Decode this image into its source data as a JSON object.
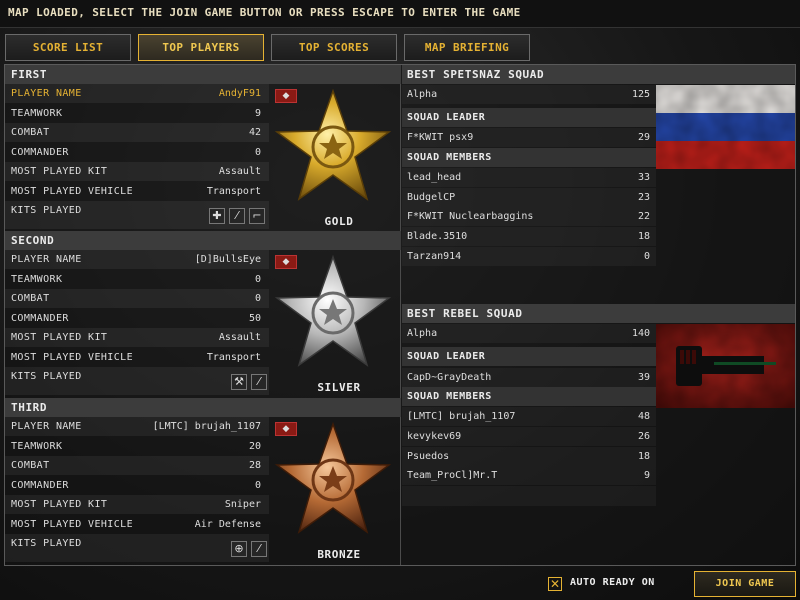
{
  "banner": "MAP LOADED, SELECT THE JOIN GAME BUTTON OR PRESS ESCAPE TO ENTER THE GAME",
  "tabs": [
    {
      "label": "SCORE LIST"
    },
    {
      "label": "TOP PLAYERS"
    },
    {
      "label": "TOP SCORES"
    },
    {
      "label": "MAP BRIEFING"
    }
  ],
  "active_tab": "TOP PLAYERS",
  "stat_labels": {
    "player_name": "PLAYER NAME",
    "teamwork": "TEAMWORK",
    "combat": "COMBAT",
    "commander": "COMMANDER",
    "kit": "MOST PLAYED KIT",
    "vehicle": "MOST PLAYED VEHICLE",
    "kits_played": "KITS PLAYED"
  },
  "players": [
    {
      "place": "FIRST",
      "medal": "GOLD",
      "name": "AndyF91",
      "teamwork": "9",
      "combat": "42",
      "commander": "0",
      "kit": "Assault",
      "vehicle": "Transport",
      "kits_played": [
        "medic-icon",
        "rifle-icon",
        "pistol-icon"
      ]
    },
    {
      "place": "SECOND",
      "medal": "SILVER",
      "name": "[D]BullsEye",
      "teamwork": "0",
      "combat": "0",
      "commander": "50",
      "kit": "Assault",
      "vehicle": "Transport",
      "kits_played": [
        "wrench-icon",
        "rifle-icon"
      ]
    },
    {
      "place": "THIRD",
      "medal": "BRONZE",
      "name": "[LMTC] brujah_1107",
      "teamwork": "20",
      "combat": "28",
      "commander": "0",
      "kit": "Sniper",
      "vehicle": "Air Defense",
      "kits_played": [
        "crosshair-icon",
        "rifle-icon"
      ]
    }
  ],
  "squads": [
    {
      "title": "BEST SPETSNAZ SQUAD",
      "squad_name": "Alpha",
      "squad_score": "125",
      "leader_label": "SQUAD LEADER",
      "leader": {
        "name": "F*KWIT psx9",
        "score": "29"
      },
      "members_label": "SQUAD MEMBERS",
      "members": [
        {
          "name": "lead_head",
          "score": "33"
        },
        {
          "name": "BudgelCP",
          "score": "23"
        },
        {
          "name": "F*KWIT Nuclearbaggins",
          "score": "22"
        },
        {
          "name": "Blade.3510",
          "score": "18"
        },
        {
          "name": "Tarzan914",
          "score": "0"
        }
      ],
      "flag": "russian-flag"
    },
    {
      "title": "BEST REBEL SQUAD",
      "squad_name": "Alpha",
      "squad_score": "140",
      "leader_label": "SQUAD LEADER",
      "leader": {
        "name": "CapD~GrayDeath",
        "score": "39"
      },
      "members_label": "SQUAD MEMBERS",
      "members": [
        {
          "name": "[LMTC] brujah_1107",
          "score": "48"
        },
        {
          "name": "kevykev69",
          "score": "26"
        },
        {
          "name": "Psuedos",
          "score": "18"
        },
        {
          "name": "Team_ProCl]Mr.T",
          "score": "9"
        }
      ],
      "flag": "rebel-fist-flag"
    }
  ],
  "bottom": {
    "auto_ready_label": "AUTO READY ON",
    "auto_ready_checked": true,
    "join_label": "JOIN GAME"
  },
  "colors": {
    "accent": "#e5b233",
    "gold": "#d4a62a",
    "silver": "#b9b9b9",
    "bronze": "#b56a35"
  }
}
